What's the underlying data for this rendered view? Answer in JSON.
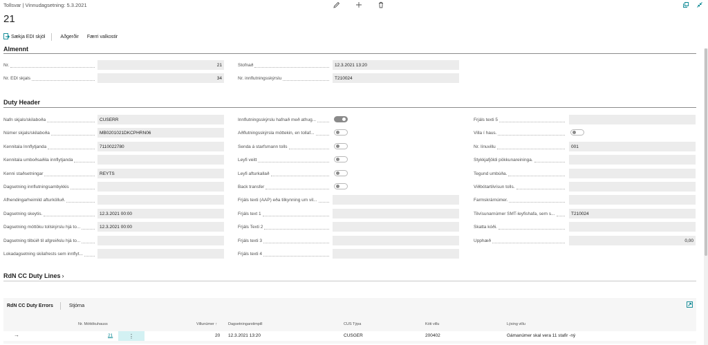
{
  "header": {
    "breadcrumb": "Tollsvar | Vinnudagsetning: 5.3.2021",
    "title": "21"
  },
  "toolbar": {
    "edit_icon": "pencil-icon",
    "new_icon": "plus-icon",
    "delete_icon": "trash-icon",
    "open_new_window_icon": "open-in-new-window-icon",
    "collapse_icon": "collapse-icon"
  },
  "actions": {
    "fetch_edi": "Sækja EDI skjöl",
    "actions": "Aðgerðir",
    "fewer_options": "Færri valkostir"
  },
  "general": {
    "title": "Almennt",
    "no_label": "Nr.",
    "no_value": "21",
    "edi_no_label": "Nr. EDI skjals",
    "edi_no_value": "34",
    "created_label": "Stofnað",
    "created_value": "12.3.2021 13:20",
    "import_no_label": "Nr. innflutningsskýrslu",
    "import_no_value": "T210024"
  },
  "duty_header": {
    "title": "Duty Header",
    "col1": [
      {
        "label": "Nafn skjals/skilaboða",
        "value": "CUSERR"
      },
      {
        "label": "Númer skjals/skilaboða",
        "value": "MB0201021DKCPHRN06"
      },
      {
        "label": "Kennitala Innflytjanda",
        "value": "7110022780"
      },
      {
        "label": "Kennitala umboðsaðila innflytjanda",
        "value": ""
      },
      {
        "label": "Kenni staðsetningar",
        "value": "REYTS"
      },
      {
        "label": "Dagsetning innflutningsambykkis",
        "value": ""
      },
      {
        "label": "Afhendingarheimild afturkölluð.",
        "value": ""
      },
      {
        "label": "Dagsetning skeytis.",
        "value": "12.3.2021 00:00"
      },
      {
        "label": "Dagsetning móttöku tollskýrslu hjá to...",
        "value": "12.3.2021 00:00"
      },
      {
        "label": "Dagsetning tilbúið til afgreiðslu hjá to...",
        "value": ""
      },
      {
        "label": "Lokadagsetning skilafrests sem innflyt...",
        "value": ""
      }
    ],
    "col2_toggles": [
      {
        "label": "Innflutningsskýrslu hafnað með athug...",
        "on": true
      },
      {
        "label": "Aðflutningsskýrsla móttekin, en tollaf...",
        "on": false
      },
      {
        "label": "Senda á starfsmann tolls",
        "on": false
      },
      {
        "label": "Leyfi veitt",
        "on": false
      },
      {
        "label": "Leyfi afturkallað",
        "on": false
      },
      {
        "label": "Back transfer",
        "on": false
      }
    ],
    "col2_fields": [
      {
        "label": "Frjáls texti (AAP) eða tilkynning um vil...",
        "value": ""
      },
      {
        "label": "Frjáls text 1",
        "value": ""
      },
      {
        "label": "Frjáls Texti 2",
        "value": ""
      },
      {
        "label": "Frjáls texti 3",
        "value": ""
      },
      {
        "label": "Frjáls texti 4",
        "value": ""
      }
    ],
    "col3_text5": {
      "label": "Frjáls texti 5",
      "value": ""
    },
    "col3_villa": {
      "label": "Villa í haus.",
      "on": false
    },
    "col3": [
      {
        "label": "Nr. línuvillu",
        "value": "001",
        "numeric": false
      },
      {
        "label": "Stykkjafjöldi pökkunareininga.",
        "value": "",
        "numeric": false
      },
      {
        "label": "Tegund umbúða.",
        "value": "",
        "numeric": false
      },
      {
        "label": "Viðbótartilvísun tolls.",
        "value": "",
        "numeric": false
      },
      {
        "label": "Farmskrárnúmer.",
        "value": "",
        "numeric": false
      },
      {
        "label": "Tilvísunarnúmer SMT-leyfishafa, sem s...",
        "value": "T210024",
        "numeric": false
      },
      {
        "label": "Skatta kóði.",
        "value": "",
        "numeric": false
      },
      {
        "label": "Upphæð",
        "value": "0,00",
        "numeric": true
      }
    ]
  },
  "lines": {
    "title": "RdN CC Duty Lines",
    "chevron_icon": "chevron-right-icon"
  },
  "errors": {
    "title": "RdN CC Duty Errors",
    "manage": "Stjórna",
    "expand_icon": "expand-icon",
    "columns": [
      "Nr. Móttökuhauss",
      "Villunúmer ↑",
      "Dagsetningarstimpill",
      "CUS Týpa",
      "Kóti villu",
      "Lýsing villu"
    ],
    "rows": [
      {
        "header_no": "21",
        "error_no": "20",
        "timestamp": "12.3.2021 13:20",
        "cus_type": "CUSGER",
        "error_code": "200402",
        "description": "Gámanúmer skal vera 11 stafir -ný"
      }
    ]
  }
}
